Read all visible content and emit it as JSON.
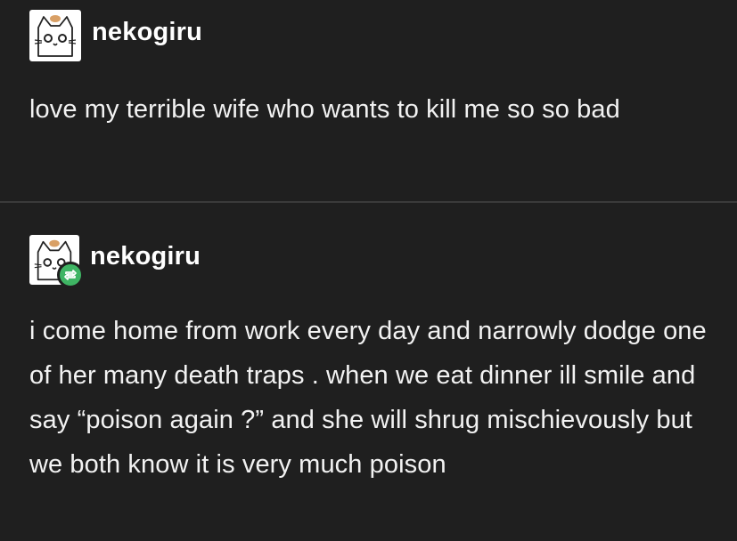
{
  "posts": [
    {
      "username": "nekogiru",
      "avatar_icon": "cat-face-icon",
      "reblog": false,
      "body": "love my terrible wife who wants to kill me so so bad"
    },
    {
      "username": "nekogiru",
      "avatar_icon": "cat-face-icon",
      "reblog": true,
      "reblog_icon": "reblog-icon",
      "reblog_color": "#3fb564",
      "body": "i come home from work every day and narrowly dodge one of her many death traps . when we eat dinner ill smile and say “poison again ?” and she will shrug mischievously but we both know it is very much poison"
    }
  ],
  "colors": {
    "background": "#1f1f1f",
    "divider": "#3a3a3a",
    "text": "#ffffff"
  }
}
